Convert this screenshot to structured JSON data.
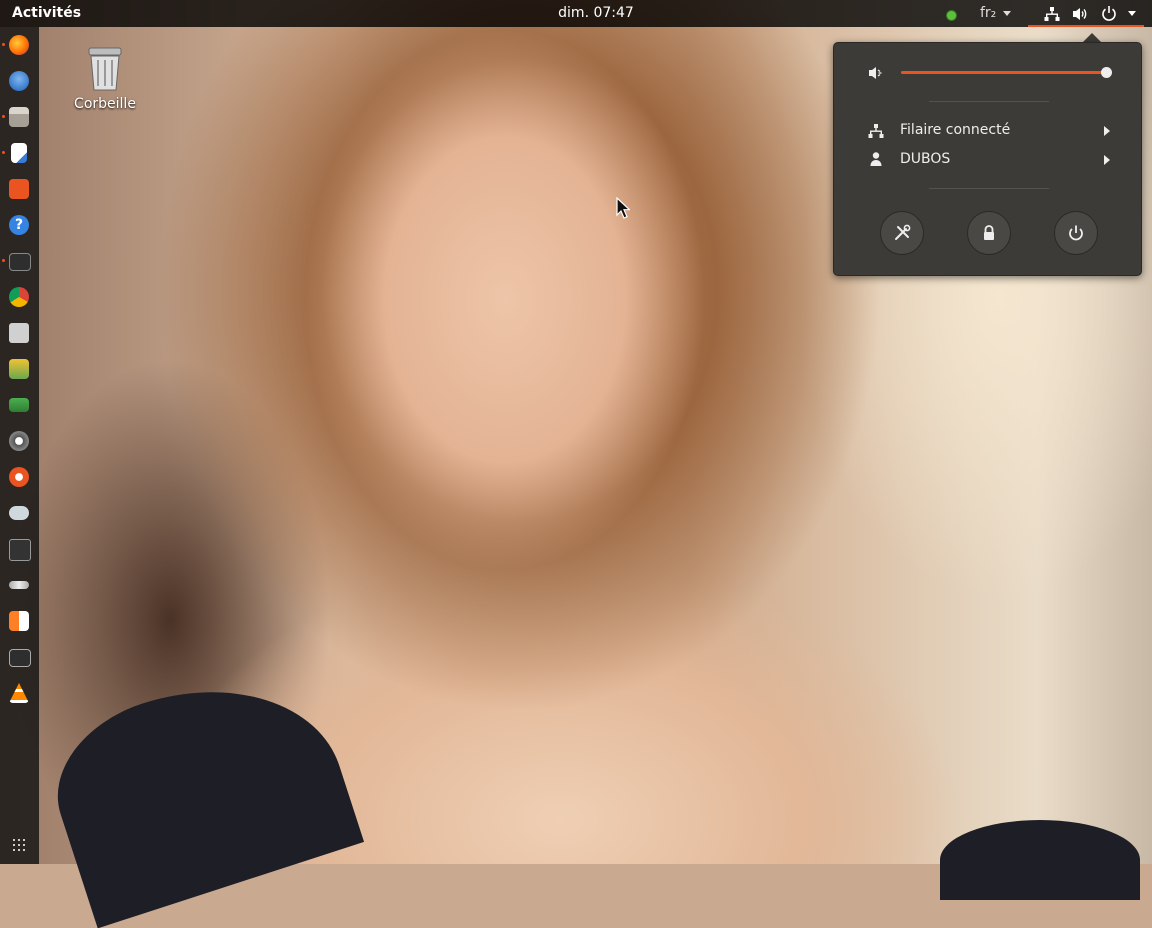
{
  "topbar": {
    "activities_label": "Activités",
    "clock": "dim. 07:47",
    "keyboard_layout": "fr₂",
    "status_icons": [
      "network-wired-icon",
      "volume-icon",
      "power-icon"
    ]
  },
  "desktop": {
    "trash_label": "Corbeille"
  },
  "dock": {
    "items": [
      {
        "name": "firefox-icon",
        "running": true
      },
      {
        "name": "thunderbird-icon",
        "running": false
      },
      {
        "name": "files-icon",
        "running": true
      },
      {
        "name": "libreoffice-writer-icon",
        "running": true
      },
      {
        "name": "software-center-icon",
        "running": false
      },
      {
        "name": "help-icon",
        "running": false
      },
      {
        "name": "terminal-icon",
        "running": true
      },
      {
        "name": "chromium-icon",
        "running": false
      },
      {
        "name": "screenshot-icon",
        "running": false
      },
      {
        "name": "image-viewer-icon",
        "running": false
      },
      {
        "name": "sage-icon",
        "running": false
      },
      {
        "name": "system-settings-icon",
        "running": false
      },
      {
        "name": "gear-app-icon",
        "running": false
      },
      {
        "name": "game-controller-icon",
        "running": false
      },
      {
        "name": "camera-icon",
        "running": false
      },
      {
        "name": "satellite-icon",
        "running": false
      },
      {
        "name": "drawing-app-icon",
        "running": false
      },
      {
        "name": "system-monitor-icon",
        "running": false
      },
      {
        "name": "vlc-icon",
        "running": false
      }
    ],
    "show_apps_icon": "grid-icon"
  },
  "system_menu": {
    "volume_level": 1.0,
    "network_label": "Filaire connecté",
    "user_label": "DUBOS",
    "buttons": [
      "settings-icon",
      "lock-icon",
      "power-off-icon"
    ]
  },
  "colors": {
    "accent": "#e95420",
    "menu_bg": "#3d3b37",
    "topbar_bg": "#000000"
  }
}
